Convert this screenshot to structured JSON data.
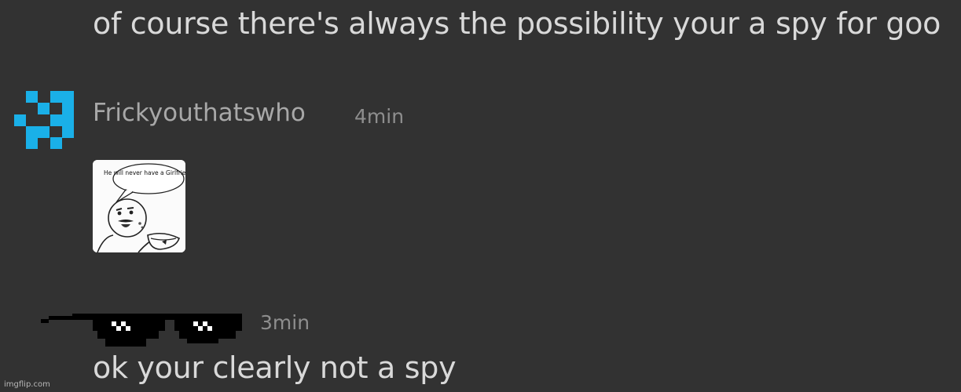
{
  "messages": [
    {
      "text": "of course there's always the possibility your a spy for goo"
    },
    {
      "author": "Frickyouthatswho",
      "time": "4min",
      "image": {
        "speech_bubble": "He will never have a Girlfriend"
      }
    },
    {
      "author": "",
      "time": "3min",
      "text": "ok your clearly not a spy"
    }
  ],
  "watermark": "imgflip.com",
  "colors": {
    "background": "#323232",
    "avatar": "#1ab0e8",
    "text": "#d9d9d9",
    "username": "#a8a8a8",
    "timestamp": "#8e8e8e"
  },
  "icons": {
    "avatar1": "pixel-identicon",
    "overlay": "pixel-sunglasses"
  }
}
